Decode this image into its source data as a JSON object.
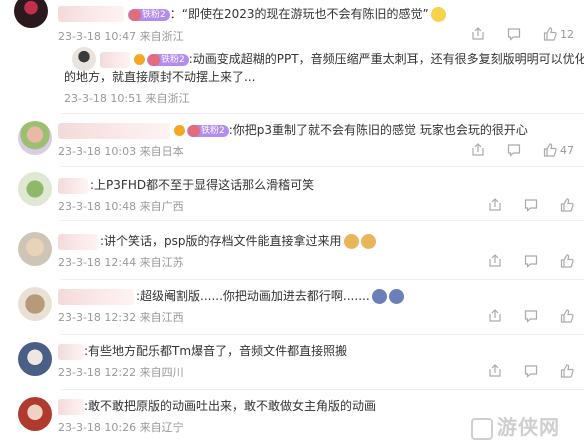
{
  "comments": [
    {
      "text": "：“即使在2023的现在游玩也不会有陈旧的感觉”",
      "badge": "铁粉2",
      "date": "23-3-18 10:47",
      "location": "来自浙江",
      "likes": "12"
    },
    {
      "text": ":动画变成超糊的PPT，音频压缩严重太刺耳，还有很多复刻版明明可以优化",
      "text2": "的地方，就直接原封不动摆上来了...",
      "badge": "铁粉2",
      "date": "23-3-18 10:51",
      "location": "来自浙江"
    },
    {
      "text": ":你把p3重制了就不会有陈旧的感觉 玩家也会玩的很开心",
      "badge": "铁粉2",
      "date": "23-3-18 10:03",
      "location": "来自日本",
      "likes": "47"
    },
    {
      "text": ":上P3FHD都不至于显得这话那么滑稽可笑",
      "date": "23-3-18 10:48",
      "location": "来自广西"
    },
    {
      "text": ":讲个笑话，psp版的存档文件能直接拿过来用",
      "date": "23-3-18 12:44",
      "location": "来自江苏"
    },
    {
      "text": ":超级阉割版......你把动画加进去都行啊.......",
      "date": "23-3-18 12:32",
      "location": "来自江西"
    },
    {
      "text": ":有些地方配乐都Tm爆音了，音频文件都直接照搬",
      "date": "23-3-18 12:22",
      "location": "来自四川"
    },
    {
      "text": ":敢不敢把原版的动画吐出来，敢不敢做女主角版的动画",
      "date": "23-3-18 10:26",
      "location": "来自辽宁"
    }
  ],
  "icons": {
    "share": "share-icon",
    "reply": "comment-icon",
    "like": "like-icon"
  },
  "watermark": "游侠网"
}
